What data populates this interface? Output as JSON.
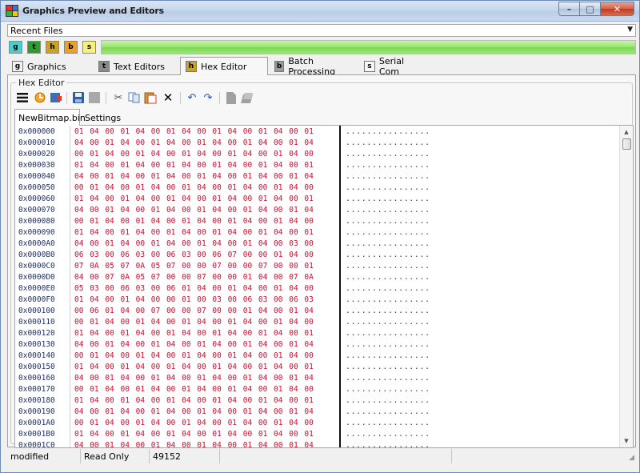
{
  "window": {
    "title": "Graphics Preview and Editors",
    "buttons": {
      "minimize": "–",
      "maximize": "□",
      "close": "✕"
    }
  },
  "recent": {
    "label": "Recent Files",
    "arrow": "▼"
  },
  "quick_buttons": [
    {
      "label": "g",
      "color": "#4ecbcb"
    },
    {
      "label": "t",
      "color": "#2a9d2a"
    },
    {
      "label": "h",
      "color": "#c9a226"
    },
    {
      "label": "b",
      "color": "#f0a020"
    },
    {
      "label": "s",
      "color": "#f7f07a"
    }
  ],
  "progress": {
    "fraction": 1.0,
    "color": "#7bd852"
  },
  "main_tabs": [
    {
      "icon": "g",
      "label": "Graphics",
      "icon_color": "#f0f0f0"
    },
    {
      "icon": "t",
      "label": "Text Editors",
      "icon_color": "#8a8a8a"
    },
    {
      "icon": "h",
      "label": "Hex Editor",
      "icon_color": "#c9a226"
    },
    {
      "icon": "b",
      "label": "Batch Processing",
      "icon_color": "#9a9a9a"
    },
    {
      "icon": "s",
      "label": "Serial Com",
      "icon_color": "#f7f7f7"
    }
  ],
  "hex_editor": {
    "group_title": "Hex Editor",
    "file_tabs": [
      "NewBitmap.bin",
      "Settings"
    ],
    "rows": [
      {
        "addr": "0x000000",
        "bytes": "01 04 00 01 04 00 01 04 00 01 04 00 01 04 00 01",
        "ascii": "................"
      },
      {
        "addr": "0x000010",
        "bytes": "04 00 01 04 00 01 04 00 01 04 00 01 04 00 01 04",
        "ascii": "................"
      },
      {
        "addr": "0x000020",
        "bytes": "00 01 04 00 01 04 00 01 04 00 01 04 00 01 04 00",
        "ascii": "................"
      },
      {
        "addr": "0x000030",
        "bytes": "01 04 00 01 04 00 01 04 00 01 04 00 01 04 00 01",
        "ascii": "................"
      },
      {
        "addr": "0x000040",
        "bytes": "04 00 01 04 00 01 04 00 01 04 00 01 04 00 01 04",
        "ascii": "................"
      },
      {
        "addr": "0x000050",
        "bytes": "00 01 04 00 01 04 00 01 04 00 01 04 00 01 04 00",
        "ascii": "................"
      },
      {
        "addr": "0x000060",
        "bytes": "01 04 00 01 04 00 01 04 00 01 04 00 01 04 00 01",
        "ascii": "................"
      },
      {
        "addr": "0x000070",
        "bytes": "04 00 01 04 00 01 04 00 01 04 00 01 04 00 01 04",
        "ascii": "................"
      },
      {
        "addr": "0x000080",
        "bytes": "00 01 04 00 01 04 00 01 04 00 01 04 00 01 04 00",
        "ascii": "................"
      },
      {
        "addr": "0x000090",
        "bytes": "01 04 00 01 04 00 01 04 00 01 04 00 01 04 00 01",
        "ascii": "................"
      },
      {
        "addr": "0x0000A0",
        "bytes": "04 00 01 04 00 01 04 00 01 04 00 01 04 00 03 00",
        "ascii": "................"
      },
      {
        "addr": "0x0000B0",
        "bytes": "06 03 00 06 03 00 06 03 00 06 07 00 00 01 04 00",
        "ascii": "................"
      },
      {
        "addr": "0x0000C0",
        "bytes": "07 0A 05 07 0A 05 07 00 00 07 00 00 07 00 00 01",
        "ascii": "................"
      },
      {
        "addr": "0x0000D0",
        "bytes": "04 00 07 0A 05 07 00 00 07 00 00 01 04 00 07 0A",
        "ascii": "................"
      },
      {
        "addr": "0x0000E0",
        "bytes": "05 03 00 06 03 00 06 01 04 00 01 04 00 01 04 00",
        "ascii": "................"
      },
      {
        "addr": "0x0000F0",
        "bytes": "01 04 00 01 04 00 00 01 00 03 00 06 03 00 06 03",
        "ascii": "................"
      },
      {
        "addr": "0x000100",
        "bytes": "00 06 01 04 00 07 00 00 07 00 00 01 04 00 01 04",
        "ascii": "................"
      },
      {
        "addr": "0x000110",
        "bytes": "00 01 04 00 01 04 00 01 04 00 01 04 00 01 04 00",
        "ascii": "................"
      },
      {
        "addr": "0x000120",
        "bytes": "01 04 00 01 04 00 01 04 00 01 04 00 01 04 00 01",
        "ascii": "................"
      },
      {
        "addr": "0x000130",
        "bytes": "04 00 01 04 00 01 04 00 01 04 00 01 04 00 01 04",
        "ascii": "................"
      },
      {
        "addr": "0x000140",
        "bytes": "00 01 04 00 01 04 00 01 04 00 01 04 00 01 04 00",
        "ascii": "................"
      },
      {
        "addr": "0x000150",
        "bytes": "01 04 00 01 04 00 01 04 00 01 04 00 01 04 00 01",
        "ascii": "................"
      },
      {
        "addr": "0x000160",
        "bytes": "04 00 01 04 00 01 04 00 01 04 00 01 04 00 01 04",
        "ascii": "................"
      },
      {
        "addr": "0x000170",
        "bytes": "00 01 04 00 01 04 00 01 04 00 01 04 00 01 04 00",
        "ascii": "................"
      },
      {
        "addr": "0x000180",
        "bytes": "01 04 00 01 04 00 01 04 00 01 04 00 01 04 00 01",
        "ascii": "................"
      },
      {
        "addr": "0x000190",
        "bytes": "04 00 01 04 00 01 04 00 01 04 00 01 04 00 01 04",
        "ascii": "................"
      },
      {
        "addr": "0x0001A0",
        "bytes": "00 01 04 00 01 04 00 01 04 00 01 04 00 01 04 00",
        "ascii": "................"
      },
      {
        "addr": "0x0001B0",
        "bytes": "01 04 00 01 04 00 01 04 00 01 04 00 01 04 00 01",
        "ascii": "................"
      },
      {
        "addr": "0x0001C0",
        "bytes": "04 00 01 04 00 01 04 00 01 04 00 01 04 00 01 04",
        "ascii": "................"
      }
    ]
  },
  "status": {
    "state": "modified",
    "mode": "Read Only",
    "size": "49152"
  }
}
